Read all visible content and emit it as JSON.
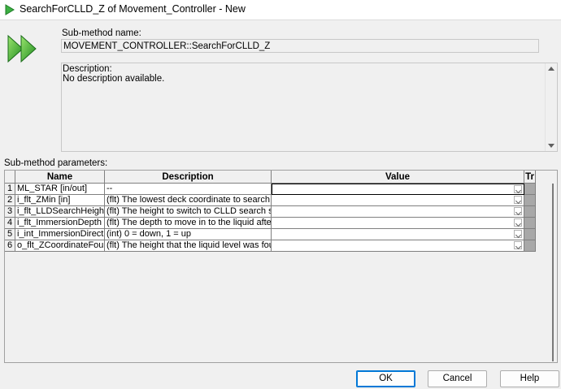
{
  "window": {
    "title": "SearchForCLLD_Z of Movement_Controller - New"
  },
  "submethod": {
    "name_label": "Sub-method name:",
    "name_value": "MOVEMENT_CONTROLLER::SearchForCLLD_Z",
    "description_label": "Description:",
    "description_value": "No description available."
  },
  "params": {
    "label": "Sub-method parameters:",
    "headers": {
      "name": "Name",
      "description": "Description",
      "value": "Value",
      "tr": "Tr"
    },
    "rows": [
      {
        "num": "1",
        "name": "ML_STAR [in/out]",
        "description": "--",
        "value": ""
      },
      {
        "num": "2",
        "name": "i_flt_ZMin [in]",
        "description": "(flt) The lowest deck coordinate to search to",
        "value": ""
      },
      {
        "num": "3",
        "name": "i_flt_LLDSearchHeight [i",
        "description": "(flt) The height to switch to CLLD search speed",
        "value": ""
      },
      {
        "num": "4",
        "name": "i_flt_ImmersionDepth [in]",
        "description": "(flt) The depth to move in to the liquid after findi",
        "value": ""
      },
      {
        "num": "5",
        "name": "i_int_ImmersionDirection",
        "description": "(int) 0 = down, 1 = up",
        "value": ""
      },
      {
        "num": "6",
        "name": "o_flt_ZCoordinateFound [",
        "description": "(flt) The height that the liquid level was found",
        "value": ""
      }
    ]
  },
  "buttons": {
    "ok": "OK",
    "cancel": "Cancel",
    "help": "Help"
  },
  "colors": {
    "accent": "#0078d7",
    "icon_green": "#3cb043"
  },
  "icons": {
    "title": "green-arrow-icon",
    "hero": "double-green-arrow-icon"
  }
}
